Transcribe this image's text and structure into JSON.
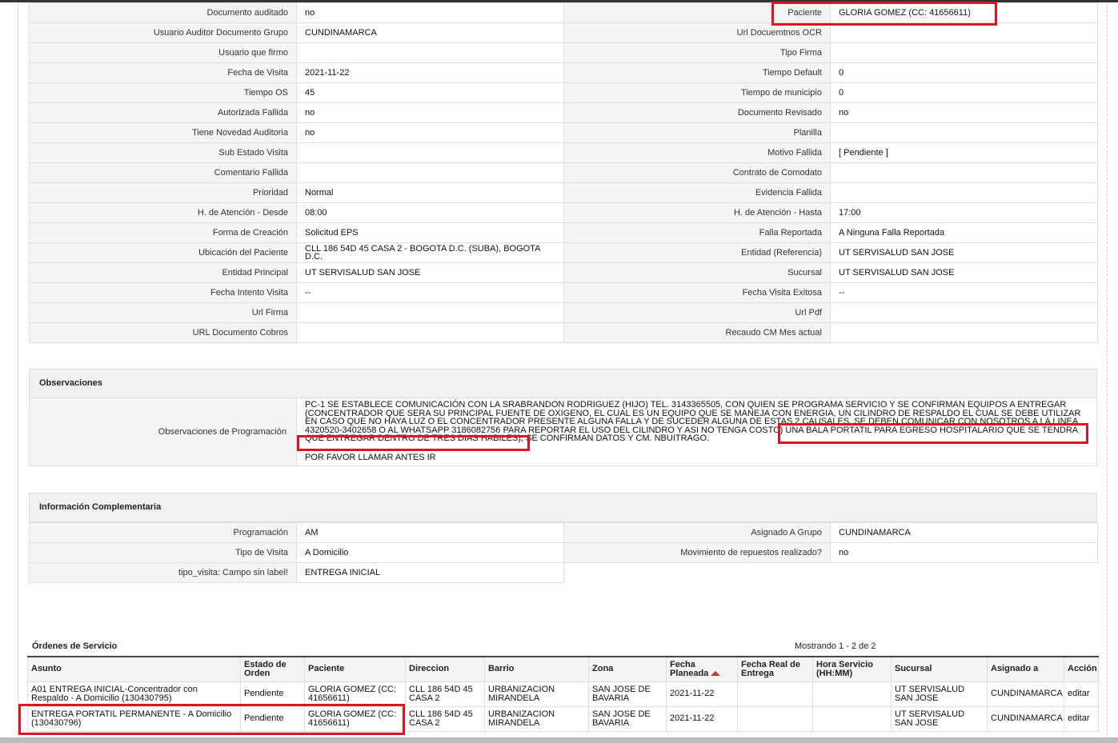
{
  "detail_rows": [
    {
      "l1": "Documento auditado",
      "v1": "no",
      "l2": "Paciente",
      "v2": "GLORIA GOMEZ (CC: 41656611)"
    },
    {
      "l1": "Usuario Auditor Documento Grupo",
      "v1": "CUNDINAMARCA",
      "l2": "Url Docuemtnos OCR",
      "v2": ""
    },
    {
      "l1": "Usuario que firmo",
      "v1": "",
      "l2": "Tipo Firma",
      "v2": ""
    },
    {
      "l1": "Fecha de Visita",
      "v1": "2021-11-22",
      "l2": "Tiempo Default",
      "v2": "0"
    },
    {
      "l1": "Tiempo OS",
      "v1": "45",
      "l2": "Tiempo de municipio",
      "v2": "0"
    },
    {
      "l1": "Autorizada Fallida",
      "v1": "no",
      "l2": "Documento Revisado",
      "v2": "no"
    },
    {
      "l1": "Tiene Novedad Auditoria",
      "v1": "no",
      "l2": "Planilla",
      "v2": ""
    },
    {
      "l1": "Sub Estado Visita",
      "v1": "",
      "l2": "Motivo Fallida",
      "v2": "[ Pendiente ]"
    },
    {
      "l1": "Comentario Fallida",
      "v1": "",
      "l2": "Contrato de Comodato",
      "v2": ""
    },
    {
      "l1": "Prioridad",
      "v1": "Normal",
      "l2": "Evidencia Fallida",
      "v2": ""
    },
    {
      "l1": "H. de Atención - Desde",
      "v1": "08:00",
      "l2": "H. de Atención - Hasta",
      "v2": "17:00"
    },
    {
      "l1": "Forma de Creación",
      "v1": "Solicitud EPS",
      "l2": "Falla Reportada",
      "v2": "A Ninguna Falla Reportada"
    },
    {
      "l1": "Ubicación del Paciente",
      "v1": "CLL 186 54D 45 CASA 2 - BOGOTA D.C. (SUBA), BOGOTA D.C.",
      "l2": "Entidad (Referencia)",
      "v2": "UT SERVISALUD SAN JOSE"
    },
    {
      "l1": "Entidad Principal",
      "v1": "UT SERVISALUD SAN JOSE",
      "l2": "Sucursal",
      "v2": "UT SERVISALUD SAN JOSE"
    },
    {
      "l1": "Fecha Intento Visita",
      "v1": "--",
      "l2": "Fecha Visita Exitosa",
      "v2": "--"
    },
    {
      "l1": "Url Firma",
      "v1": "",
      "l2": "Url Pdf",
      "v2": ""
    },
    {
      "l1": "URL Documento Cobros",
      "v1": "",
      "l2": "Recaudo CM Mes actual",
      "v2": ""
    }
  ],
  "observaciones": {
    "title": "Observaciones",
    "label": "Observaciones de Programación",
    "line1": "  PC-1 SE ESTABLECE COMUNICACIÓN CON LA SRABRANDON RODRIGUEZ (HIJO) TEL. 3143365505, CON QUIEN SE PROGRAMA SERVICIO Y SE CONFIRMAN EQUIPOS A ENTREGAR (CONCENTRADOR QUE SERA SU PRINCIPAL FUENTE DE OXIGENO, EL CUAL ES UN EQUIPO QUE SE MANEJA CON ENERGIA, UN CILINDRO DE RESPALDO EL CUAL SE DEBE UTILIZAR EN CASO QUE NO HAYA LUZ O EL CONCENTRADOR PRESENTE ALGUNA FALLA Y DE SUCEDER ALGUNA DE ESTAS 2 CAUSALES, SE DEBEN COMUNICAR CON NOSOTROS A LA LINEA 4320520-3402658 O AL WHATSAPP 3186082756 PARA REPORTAR EL USO DEL CILINDRO Y ASI NO TENGA COSTO) UNA BALA PORTATIL PARA EGRESO HOSPITALARIO QUE SE TENDRA QUE ENTREGAR DENTRO DE TRES DIAS HABILES), SE CONFIRMAN DATOS Y CM. NBUITRAGO.",
    "line2": "POR FAVOR LLAMAR ANTES IR"
  },
  "complementaria": {
    "title": "Información Complementaria",
    "rows": [
      {
        "l1": "Programación",
        "v1": "AM",
        "l2": "Asignado A Grupo",
        "v2": "CUNDINAMARCA"
      },
      {
        "l1": "Tipo de Visita",
        "v1": "A Domicilio",
        "l2": "Movimiento de repuestos realizado?",
        "v2": "no"
      },
      {
        "l1": "tipo_visita: Campo sin label!",
        "v1": "ENTREGA INICIAL"
      }
    ]
  },
  "ordenes": {
    "title": "Órdenes de Servicio",
    "showing": "Mostrando 1 - 2 de 2",
    "headers": [
      "Asunto",
      "Estado de Orden",
      "Paciente",
      "Direccion",
      "Barrio",
      "Zona",
      "Fecha Planeada",
      "Fecha Real de Entrega",
      "Hora Servicio (HH:MM)",
      "Sucursal",
      "Asignado a",
      "Acción"
    ],
    "rows": [
      [
        "A01 ENTREGA INICIAL-Concentrador con Respaldo - A Domicilio (130430795)",
        "Pendiente",
        "GLORIA GOMEZ (CC: 41656611)",
        "CLL 186 54D 45 CASA 2",
        "URBANIZACION MIRANDELA",
        "SAN JOSE DE BAVARIA",
        "2021-11-22",
        "",
        "",
        "UT SERVISALUD SAN JOSE",
        "CUNDINAMARCA",
        "editar"
      ],
      [
        "ENTREGA PORTATIL PERMANENTE - A Domicilio (130430796)",
        "Pendiente",
        "GLORIA GOMEZ (CC: 41656611)",
        "CLL 186 54D 45 CASA 2",
        "URBANIZACION MIRANDELA",
        "SAN JOSE DE BAVARIA",
        "2021-11-22",
        "",
        "",
        "UT SERVISALUD SAN JOSE",
        "CUNDINAMARCA",
        "editar"
      ]
    ]
  },
  "colors": {
    "highlight": "#e0141e",
    "label_bg": "#f4f4f4",
    "border": "#dedede"
  }
}
